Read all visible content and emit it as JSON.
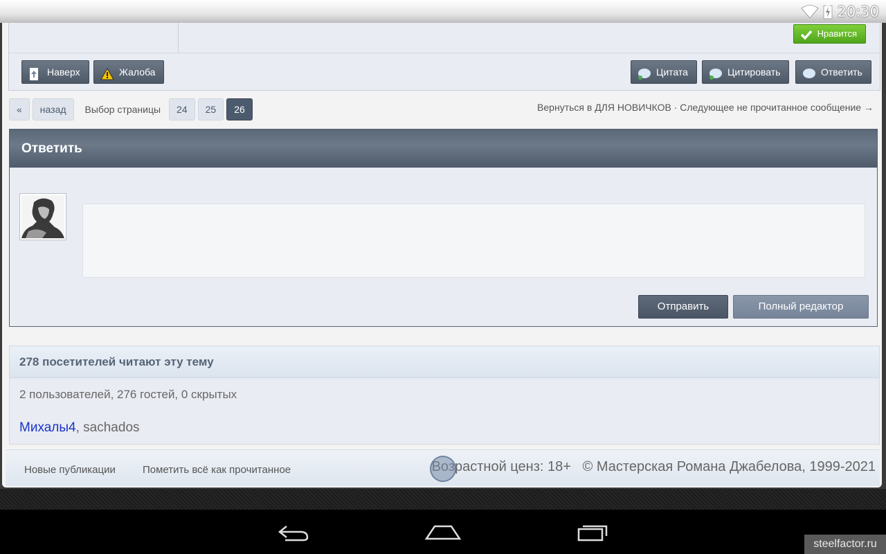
{
  "status_bar": {
    "time": "20:30"
  },
  "post": {
    "like_label": "Нравится",
    "controls": {
      "top_label": "Наверх",
      "report_label": "Жалоба",
      "quote_label": "Цитата",
      "multiquote_label": "Цитировать",
      "reply_label": "Ответить"
    }
  },
  "pagination": {
    "first": "«",
    "prev": "назад",
    "label": "Выбор страницы",
    "pages": [
      "24",
      "25",
      "26"
    ],
    "current": "26"
  },
  "topic_nav": {
    "back_text": "Вернуться в ДЛЯ НОВИЧКОВ",
    "separator": "·",
    "next_text": "Следующее не прочитанное сообщение →"
  },
  "reply": {
    "title": "Ответить",
    "send_label": "Отправить",
    "full_editor_label": "Полный редактор"
  },
  "readers": {
    "title": "278 посетителей читают эту тему",
    "summary": "2 пользователей, 276 гостей, 0 скрытых",
    "users": [
      "Михалы4",
      "sachados"
    ]
  },
  "footer": {
    "new_posts": "Новые публикации",
    "mark_read": "Пометить всё как прочитанное",
    "age_rating": "Возрастной ценз: 18+",
    "copyright": "© Мастерская Романа Джабелова, 1999-2021"
  },
  "watermark": "steelfactor.ru"
}
